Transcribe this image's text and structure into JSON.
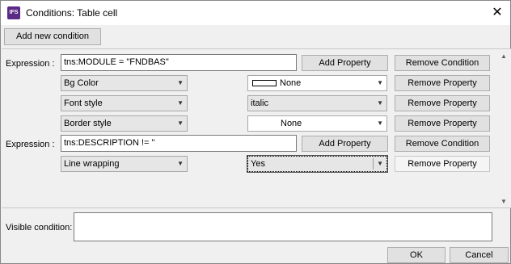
{
  "window": {
    "title": "Conditions: Table cell",
    "app_icon_text": "IFS",
    "close_glyph": "✕"
  },
  "toolbar": {
    "add_condition_label": "Add new condition"
  },
  "conditions": [
    {
      "label": "Expression :",
      "expression": "tns:MODULE = \"FNDBAS\"",
      "add_property_label": "Add Property",
      "remove_condition_label": "Remove Condition",
      "properties": [
        {
          "name": "Bg Color",
          "value": "None",
          "remove_label": "Remove Property",
          "value_color": "#ffffff"
        },
        {
          "name": "Font style",
          "value": "italic",
          "remove_label": "Remove Property"
        },
        {
          "name": "Border style",
          "value": "None",
          "remove_label": "Remove Property"
        }
      ]
    },
    {
      "label": "Expression :",
      "expression": "tns:DESCRIPTION != ''",
      "add_property_label": "Add Property",
      "remove_condition_label": "Remove Condition",
      "properties": [
        {
          "name": "Line wrapping",
          "value": "Yes",
          "remove_label": "Remove Property"
        }
      ]
    }
  ],
  "visible_condition": {
    "label": "Visible condition:",
    "value": ""
  },
  "footer": {
    "ok_label": "OK",
    "cancel_label": "Cancel"
  },
  "icons": {
    "dropdown": "chevron-down-icon",
    "close": "close-icon"
  }
}
